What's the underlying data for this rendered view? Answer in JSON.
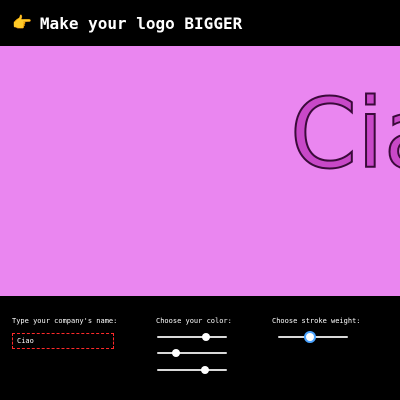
{
  "header": {
    "pointer_icon": "👉",
    "title": "Make your logo BIGGER"
  },
  "canvas": {
    "background": "#ea86f0",
    "logo_text": "Ciao",
    "logo_fill": "#c848c8",
    "logo_stroke": "#3a0a3a"
  },
  "controls": {
    "name_label": "Type your company's name:",
    "name_value": "Ciao",
    "color_label": "Choose your color:",
    "color_sliders": [
      {
        "value": 0.7
      },
      {
        "value": 0.27
      },
      {
        "value": 0.68
      }
    ],
    "stroke_label": "Choose stroke weight:",
    "stroke_slider": {
      "value": 0.45
    }
  }
}
